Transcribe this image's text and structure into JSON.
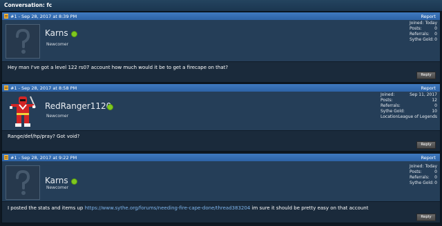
{
  "conversation": {
    "title": "Conversation: fc"
  },
  "common": {
    "report_label": "Report",
    "reply_label": "Reply"
  },
  "posts": [
    {
      "number": "#1 - Sep 28, 2017 at 8:39 PM",
      "username": "Karns",
      "role": "Newcomer",
      "avatar": "placeholder-avatar",
      "stats": [
        {
          "label": "Joined:",
          "value": "Today"
        },
        {
          "label": "Posts:",
          "value": "0"
        },
        {
          "label": "Referrals:",
          "value": "0"
        },
        {
          "label": "Sythe Gold:",
          "value": "0"
        }
      ],
      "message": "Hey man I've got a level 122 rs07 account how much would it be to get a firecape on that?"
    },
    {
      "number": "#1 - Sep 28, 2017 at 8:58 PM",
      "username": "RedRanger1120",
      "role": "Newcomer",
      "avatar": "red-ranger-sprite",
      "stats": [
        {
          "label": "Joined:",
          "value": "Sep 11, 2017"
        },
        {
          "label": "Posts:",
          "value": "12"
        },
        {
          "label": "Referrals:",
          "value": "0"
        },
        {
          "label": "Sythe Gold:",
          "value": "10"
        },
        {
          "label": "Location:",
          "value": "League of Legends"
        }
      ],
      "message": "Range/def/hp/pray? Got void?"
    },
    {
      "number": "#1 - Sep 28, 2017 at 9:22 PM",
      "username": "Karns",
      "role": "Newcomer",
      "avatar": "placeholder-avatar",
      "stats": [
        {
          "label": "Joined:",
          "value": "Today"
        },
        {
          "label": "Posts:",
          "value": "0"
        },
        {
          "label": "Referrals:",
          "value": "0"
        },
        {
          "label": "Sythe Gold:",
          "value": "0"
        }
      ],
      "message_before": "I posted the stats and items up ",
      "message_link": "https://www.sythe.org/forums/needing-fire-cape-done/thread383204",
      "message_after": " im sure it should be pretty easy on that account"
    }
  ],
  "colors": {
    "post_bar": "#3f79bf",
    "userinfo_bg": "#253e58",
    "online_dot": "#7fc81f",
    "link": "#7fb6ee"
  }
}
